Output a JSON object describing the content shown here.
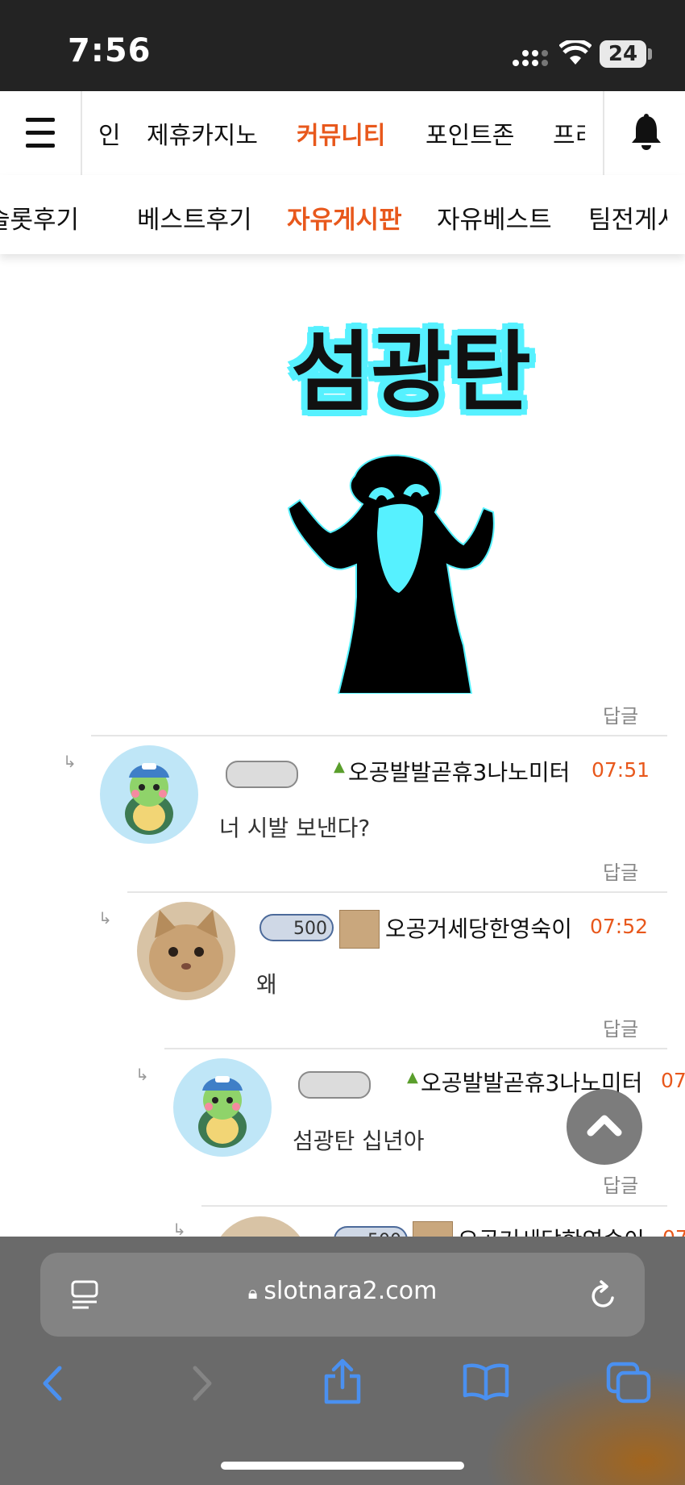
{
  "status_bar": {
    "time": "7:56",
    "battery": "24"
  },
  "top_nav": {
    "items": [
      {
        "label": "인"
      },
      {
        "label": "제휴카지노"
      },
      {
        "label": "커뮤니티",
        "active": true
      },
      {
        "label": "포인트존"
      },
      {
        "label": "프리"
      }
    ]
  },
  "sub_nav": {
    "items": [
      {
        "label": "슬롯후기"
      },
      {
        "label": "베스트후기"
      },
      {
        "label": "자유게시판",
        "active": true
      },
      {
        "label": "자유베스트"
      },
      {
        "label": "팀전게시"
      }
    ]
  },
  "post": {
    "image_text": "섬광탄",
    "reply_label": "답글"
  },
  "comments": [
    {
      "level": "",
      "name": "오공발발곧휴3나노미터",
      "time": "07:51",
      "text": "너 시발 보낸다?",
      "reply": "답글",
      "avatar": "turtle"
    },
    {
      "level": "500",
      "name": "오공거세당한영숙이",
      "time": "07:52",
      "text": "왜",
      "reply": "답글",
      "avatar": "cat"
    },
    {
      "level": "",
      "name": "오공발발곧휴3나노미터",
      "time": "07",
      "text": "섬광탄 십년아",
      "reply": "답글",
      "avatar": "turtle"
    },
    {
      "level": "500",
      "name": "오공거세당한영숙이",
      "time": "07",
      "text": "",
      "reply": "",
      "avatar": "cat"
    }
  ],
  "browser": {
    "url": "slotnara2.com"
  },
  "colors": {
    "accent": "#e8581c",
    "cyan": "#56f1ff"
  }
}
